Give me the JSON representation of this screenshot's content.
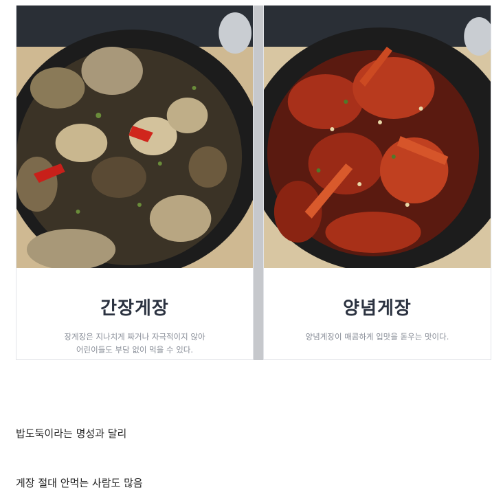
{
  "cards": [
    {
      "title": "간장게장",
      "desc_line1": "장게장은 지나치게 짜거나 자극적이지 않아",
      "desc_line2": "어린이들도 부담 없이 먹을 수 있다."
    },
    {
      "title": "양념게장",
      "desc_line1": "양념게장이 매콤하게 입맛을 돋우는 맛이다.",
      "desc_line2": ""
    }
  ],
  "body": {
    "line1": "밥도둑이라는 명성과 달리",
    "line2": "게장 절대 안먹는 사람도 많음"
  },
  "colors": {
    "title": "#2b3240",
    "desc": "#8a8f99",
    "divider": "#c6c8cc",
    "soy_crab": "#6b5a3e",
    "spicy_crab": "#b8321a"
  }
}
